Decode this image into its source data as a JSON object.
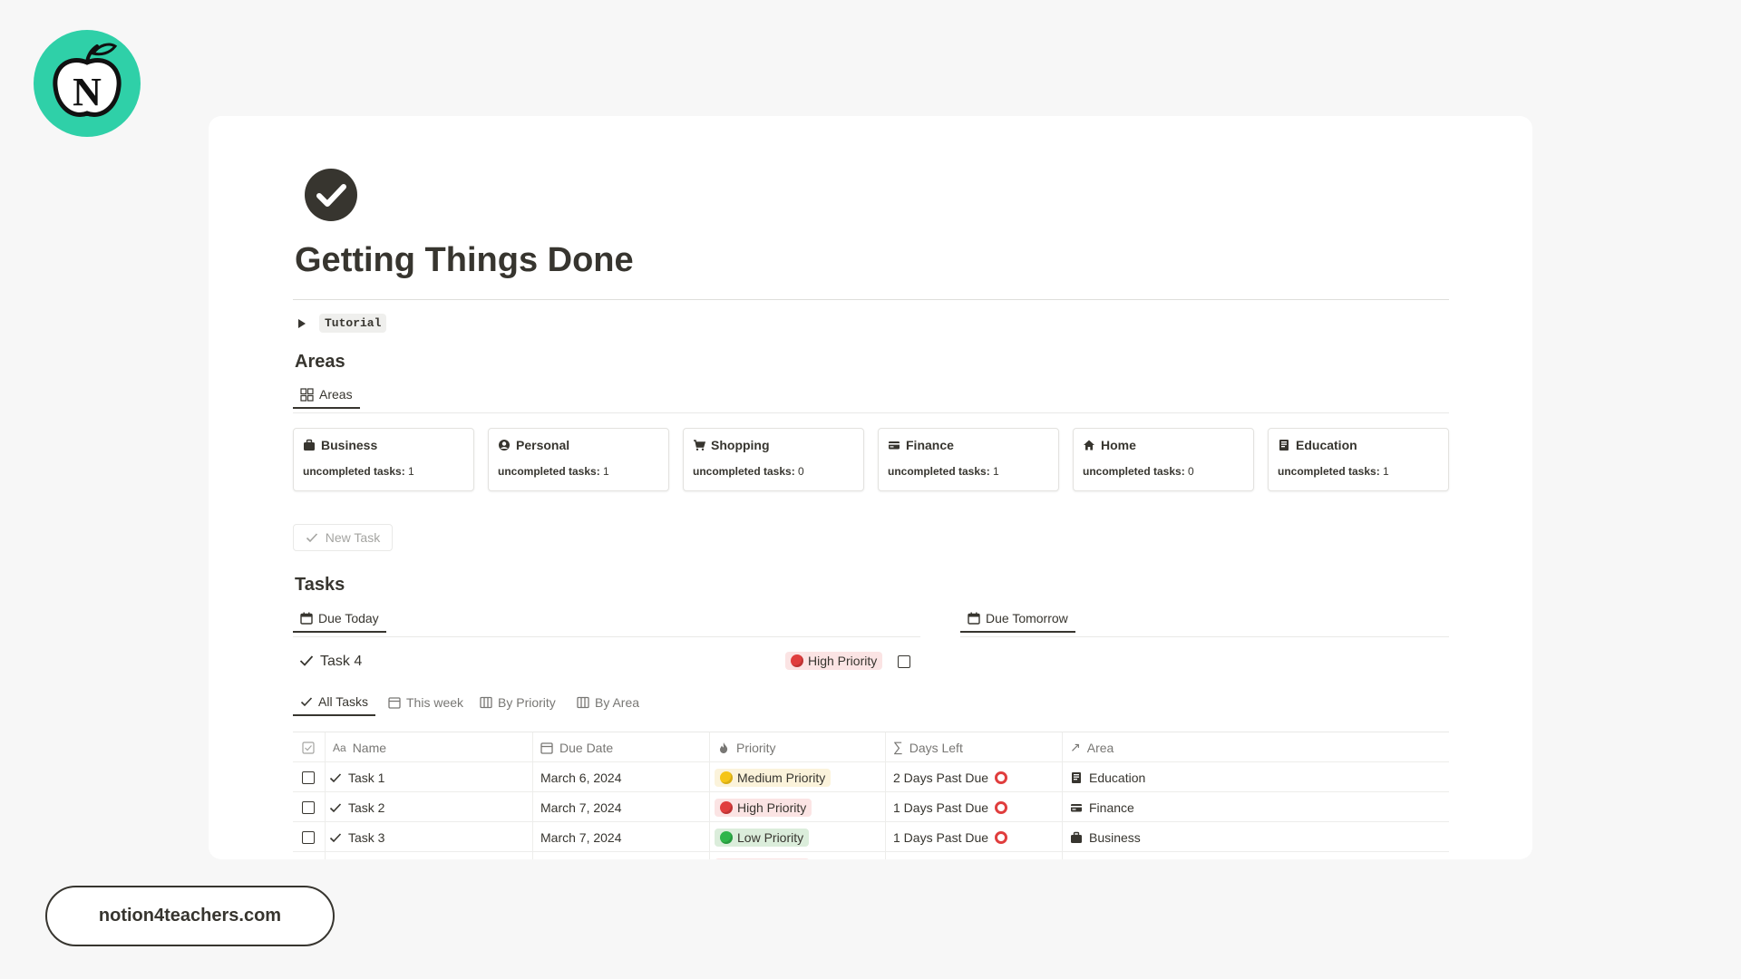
{
  "logo": {
    "letter": "N"
  },
  "page": {
    "title": "Getting Things Done",
    "toggle_label": "Tutorial"
  },
  "areas": {
    "heading": "Areas",
    "view_tab": "Areas",
    "cards": [
      {
        "name": "Business",
        "icon": "briefcase-icon",
        "meta_label": "uncompleted tasks:",
        "meta_value": "1"
      },
      {
        "name": "Personal",
        "icon": "person-icon",
        "meta_label": "uncompleted tasks:",
        "meta_value": "1"
      },
      {
        "name": "Shopping",
        "icon": "cart-icon",
        "meta_label": "uncompleted tasks:",
        "meta_value": "0"
      },
      {
        "name": "Finance",
        "icon": "credit-card-icon",
        "meta_label": "uncompleted tasks:",
        "meta_value": "1"
      },
      {
        "name": "Home",
        "icon": "house-icon",
        "meta_label": "uncompleted tasks:",
        "meta_value": "0"
      },
      {
        "name": "Education",
        "icon": "book-icon",
        "meta_label": "uncompleted tasks:",
        "meta_value": "1"
      }
    ]
  },
  "new_task_label": "New Task",
  "tasks": {
    "heading": "Tasks",
    "due_today_tab": "Due Today",
    "due_tomorrow_tab": "Due Tomorrow",
    "today_item": {
      "name": "Task 4",
      "priority": "High Priority"
    },
    "views": [
      "All Tasks",
      "This week",
      "By Priority",
      "By Area"
    ],
    "columns": [
      "Name",
      "Due Date",
      "Priority",
      "Days Left",
      "Area"
    ],
    "name_prefix": "Aa",
    "rows": [
      {
        "name": "Task 1",
        "due": "March 6, 2024",
        "priority": "Medium Priority",
        "priority_level": "medium",
        "days_left": "2 Days Past Due",
        "area": "Education",
        "area_icon": "book-icon"
      },
      {
        "name": "Task 2",
        "due": "March 7, 2024",
        "priority": "High Priority",
        "priority_level": "high",
        "days_left": "1 Days Past Due",
        "area": "Finance",
        "area_icon": "credit-card-icon"
      },
      {
        "name": "Task 3",
        "due": "March 7, 2024",
        "priority": "Low Priority",
        "priority_level": "low",
        "days_left": "1 Days Past Due",
        "area": "Business",
        "area_icon": "briefcase-icon"
      }
    ]
  },
  "footer": {
    "url": "notion4teachers.com"
  },
  "colors": {
    "logo_bg": "#2fd0a8",
    "text": "#37352f",
    "high": "#e03e3e",
    "medium": "#f5c518",
    "low": "#2fb54a"
  }
}
